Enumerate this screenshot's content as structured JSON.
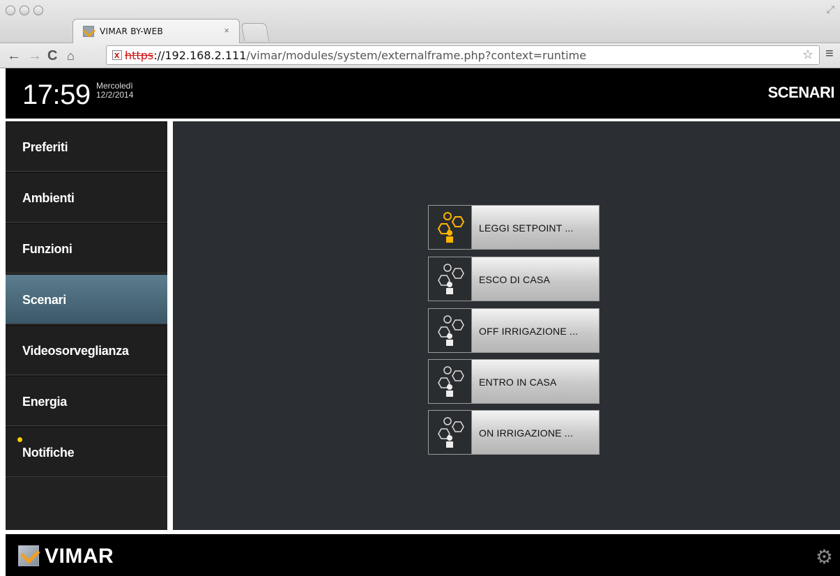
{
  "browser": {
    "tab_title": "VIMAR BY-WEB",
    "tab_close": "×",
    "url_scheme": "https",
    "url_host": "://192.168.2.111",
    "url_path": "/vimar/modules/system/externalframe.php?context=runtime"
  },
  "header": {
    "time": "17:59",
    "weekday": "Mercoledì",
    "date": "12/2/2014",
    "section": "SCENARI"
  },
  "sidebar": {
    "items": [
      {
        "label": "Preferiti"
      },
      {
        "label": "Ambienti"
      },
      {
        "label": "Funzioni"
      },
      {
        "label": "Scenari",
        "active": true
      },
      {
        "label": "Videosorveglianza"
      },
      {
        "label": "Energia"
      },
      {
        "label": "Notifiche",
        "has_indicator": true
      }
    ]
  },
  "scenes": [
    {
      "label": "LEGGI SETPOINT ...",
      "icon": "scene-icon",
      "active": true
    },
    {
      "label": "ESCO DI CASA",
      "icon": "scene-icon"
    },
    {
      "label": "OFF IRRIGAZIONE ...",
      "icon": "scene-icon"
    },
    {
      "label": "ENTRO IN CASA",
      "icon": "scene-icon"
    },
    {
      "label": "ON IRRIGAZIONE ...",
      "icon": "scene-icon"
    }
  ],
  "footer": {
    "brand": "VIMAR",
    "settings_icon": "gear-icon"
  },
  "colors": {
    "active_nav": "#4a6b7c",
    "scene_active_icon": "#ffb400",
    "notification_dot": "#ffcc00"
  }
}
